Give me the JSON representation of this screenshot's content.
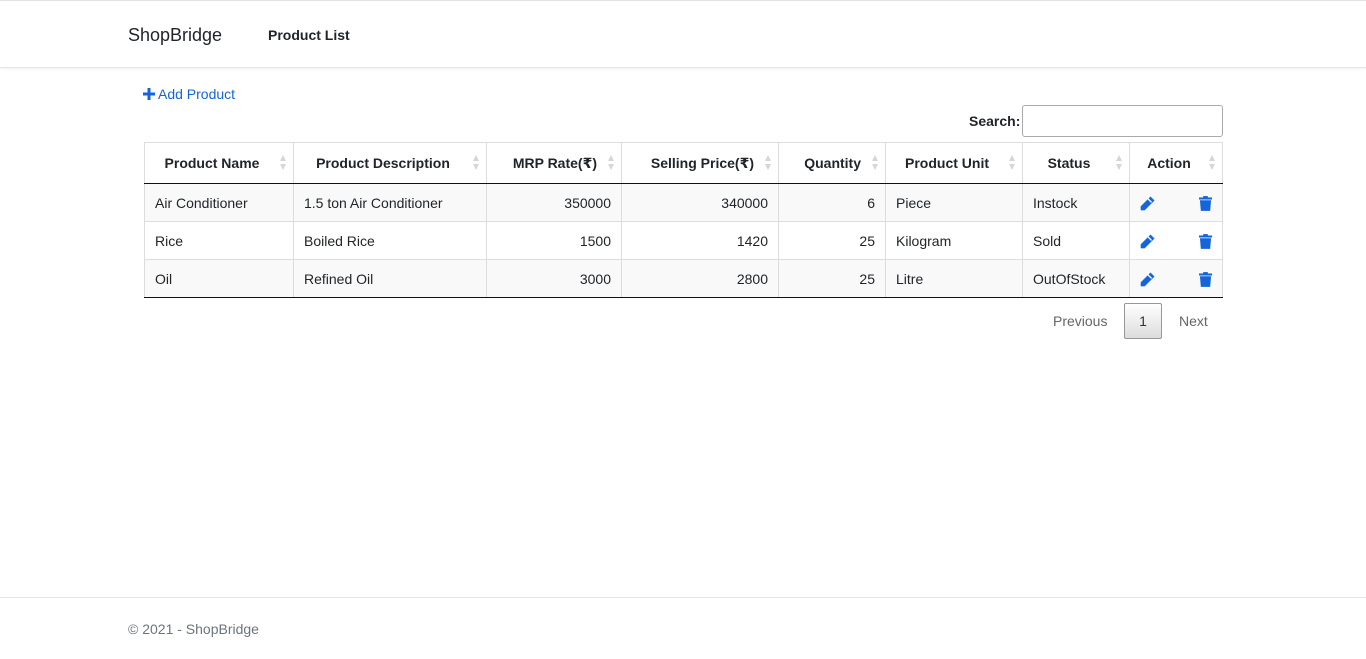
{
  "navbar": {
    "brand": "ShopBridge",
    "link": "Product List"
  },
  "toolbar": {
    "add_label": "Add Product",
    "search_label": "Search:",
    "search_value": ""
  },
  "colors": {
    "accent": "#1565d8",
    "sort_arrow": "#d6d6d6",
    "stripe": "#f9f9f9"
  },
  "table": {
    "columns": [
      "Product Name",
      "Product Description",
      "MRP Rate(₹)",
      "Selling Price(₹)",
      "Quantity",
      "Product Unit",
      "Status",
      "Action"
    ],
    "rows": [
      {
        "name": "Air Conditioner",
        "description": "1.5 ton Air Conditioner",
        "mrp": "350000",
        "selling": "340000",
        "quantity": "6",
        "unit": "Piece",
        "status": "Instock"
      },
      {
        "name": "Rice",
        "description": "Boiled Rice",
        "mrp": "1500",
        "selling": "1420",
        "quantity": "25",
        "unit": "Kilogram",
        "status": "Sold"
      },
      {
        "name": "Oil",
        "description": "Refined Oil",
        "mrp": "3000",
        "selling": "2800",
        "quantity": "25",
        "unit": "Litre",
        "status": "OutOfStock"
      }
    ],
    "action_icons": [
      "pencil-icon",
      "trash-icon"
    ]
  },
  "pagination": {
    "previous": "Previous",
    "current": "1",
    "next": "Next"
  },
  "footer": {
    "text": "© 2021 - ShopBridge"
  }
}
